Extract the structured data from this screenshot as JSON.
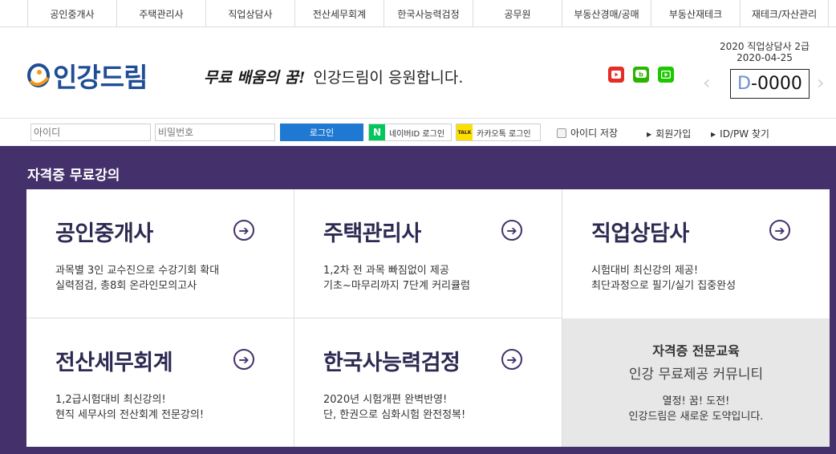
{
  "topnav": {
    "items": [
      {
        "label": "공인중개사",
        "w": 111
      },
      {
        "label": "주택관리사",
        "w": 111
      },
      {
        "label": "직업상담사",
        "w": 111
      },
      {
        "label": "전산세무회계",
        "w": 111
      },
      {
        "label": "한국사능력검정",
        "w": 111
      },
      {
        "label": "공무원",
        "w": 111
      },
      {
        "label": "부동산경매/공매",
        "w": 111
      },
      {
        "label": "부동산재테크",
        "w": 111
      },
      {
        "label": "재테크/자산관리",
        "w": 110
      }
    ]
  },
  "header": {
    "logo_text": "인강드림",
    "slogan_script": "무료 배움의 꿈!",
    "slogan_text": "인강드림이 응원합니다.",
    "social": [
      {
        "name": "youtube-icon",
        "color": "#e52d27"
      },
      {
        "name": "blog-icon",
        "color": "#2db400"
      },
      {
        "name": "naver-tv-icon",
        "color": "#1ec800"
      }
    ],
    "dday": {
      "title": "2020 직업상담사 2급",
      "date": "2020-04-25",
      "prefix": "D",
      "value": "-0000"
    }
  },
  "login": {
    "id_placeholder": "아이디",
    "pw_placeholder": "비밀번호",
    "login_label": "로그인",
    "naver_label": "네이버ID 로그인",
    "naver_badge": "N",
    "kakao_label": "카카오톡 로그인",
    "kakao_badge": "TALK",
    "save_id_label": "아이디 저장",
    "signup_label": "회원가입",
    "find_label": "ID/PW 찾기"
  },
  "section": {
    "title": "자격증 무료강의",
    "cards": [
      {
        "title": "공인중개사",
        "line1": "과목별 3인 교수진으로 수강기회 확대",
        "line2": "실력점검, 총8회 온라인모의고사"
      },
      {
        "title": "주택관리사",
        "line1": "1,2차 전 과목 빠짐없이 제공",
        "line2": "기초~마무리까지 7단계 커리큘럼"
      },
      {
        "title": "직업상담사",
        "line1": "시험대비 최신강의 제공!",
        "line2": "최단과정으로 필기/실기 집중완성"
      },
      {
        "title": "전산세무회계",
        "line1": "1,2급시험대비 최신강의!",
        "line2": "현직 세무사의 전산회계 전문강의!"
      },
      {
        "title": "한국사능력검정",
        "line1": "2020년 시험개편 완벽반영!",
        "line2": "단, 한권으로 심화시험 완전정복!"
      }
    ],
    "promo": {
      "line1": "자격증 전문교육",
      "line2": "인강 무료제공 커뮤니티",
      "line3": "열정! 꿈! 도전!",
      "line4": "인강드림은 새로운 도약입니다."
    }
  },
  "colors": {
    "brand_blue": "#1f4d96",
    "section_bg": "#44316c",
    "login_button": "#1f78d1",
    "naver_green": "#03c75a",
    "kakao_yellow": "#fae100"
  }
}
